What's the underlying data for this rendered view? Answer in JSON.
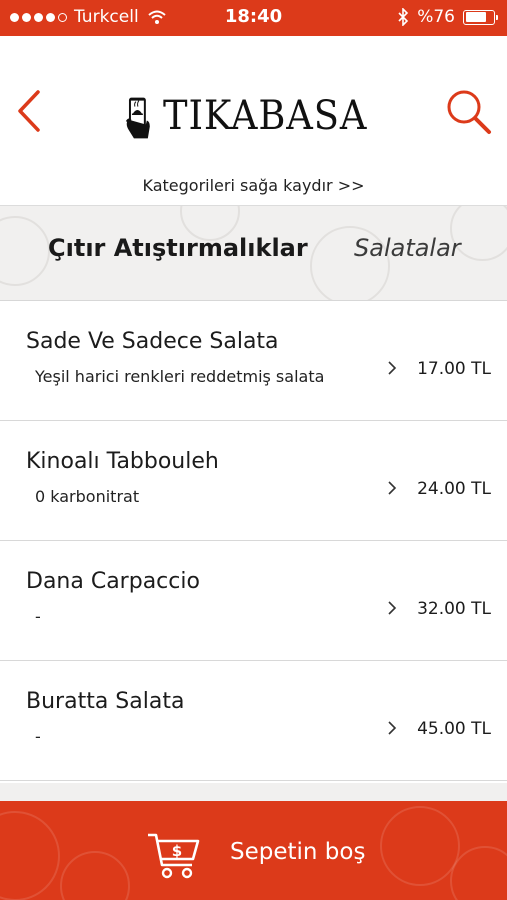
{
  "status_bar": {
    "carrier": "Turkcell",
    "time": "18:40",
    "battery_text": "%76",
    "battery_level": 0.76
  },
  "header": {
    "logo_text": "TIKABASA",
    "hint": "Kategorileri sağa kaydır >>"
  },
  "tabs": {
    "active": "Çıtır Atıştırmalıklar",
    "next": "Salatalar"
  },
  "menu_items": [
    {
      "name": "Sade Ve Sadece Salata",
      "description": "Yeşil harici renkleri reddetmiş salata",
      "price": "17.00 TL"
    },
    {
      "name": "Kinoalı Tabbouleh",
      "description": "0 karbonitrat",
      "price": "24.00 TL"
    },
    {
      "name": "Dana Carpaccio",
      "description": "-",
      "price": "32.00 TL"
    },
    {
      "name": "Buratta Salata",
      "description": "-",
      "price": "45.00 TL"
    }
  ],
  "cart": {
    "label": "Sepetin boş"
  },
  "colors": {
    "brand_red": "#dc3a1a",
    "list_bg": "#ffffff",
    "tab_bg": "#f1f0ef"
  }
}
